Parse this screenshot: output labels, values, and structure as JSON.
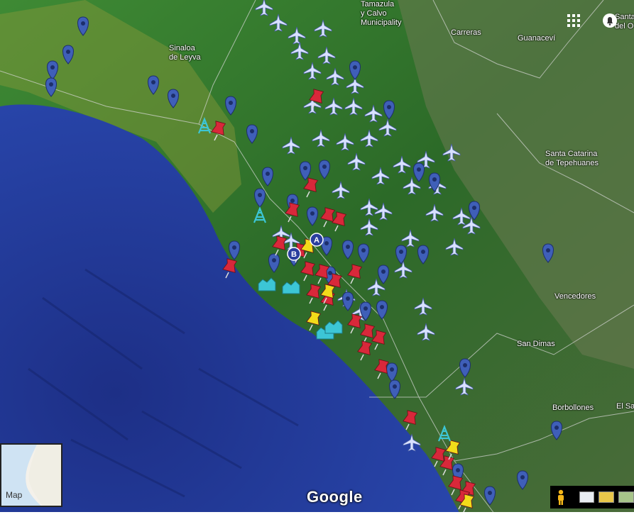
{
  "map": {
    "places": [
      {
        "name": "Sinaloa\nde Leyva"
      },
      {
        "name": "Tamazula\ny Calvo\nMunicipality"
      },
      {
        "name": "Carreras"
      },
      {
        "name": "Guanaceví"
      },
      {
        "name": "Santa Catarina\nde Tepehuanes"
      },
      {
        "name": "Vencedores"
      },
      {
        "name": "San Dimas"
      },
      {
        "name": "Borbollones"
      },
      {
        "name": "El Sa"
      },
      {
        "name": "Santa M\ndel O"
      }
    ],
    "labels": {
      "google": "Google",
      "minimap": "Map",
      "marker_a": "A",
      "marker_b": "B"
    },
    "colors": {
      "ocean": "#1f3a9a",
      "land": "#2e6e2a",
      "pin_blue": "#3f5fb8",
      "pin_red": "#d8283a",
      "pin_yellow": "#f2dc1a",
      "plane": "#d9e2ff",
      "tower": "#3cc6d6"
    },
    "icons": {
      "apps": "grid-icon",
      "notifications": "bell-icon",
      "pegman": "pegman-icon"
    }
  }
}
